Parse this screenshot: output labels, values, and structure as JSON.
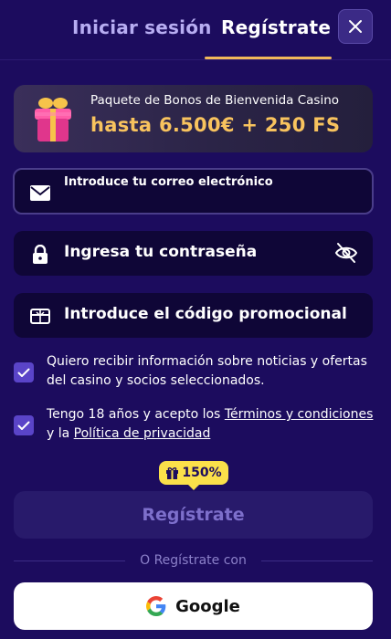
{
  "tabs": {
    "login": "Iniciar sesión",
    "register": "Regístrate",
    "active": "register"
  },
  "close_icon": "close-icon",
  "bonus": {
    "title": "Paquete de Bonos de Bienvenida Casino",
    "amount": "hasta 6.500€ + 250 FS",
    "icon": "gift-icon"
  },
  "form": {
    "email_placeholder": "Introduce tu correo electrónico",
    "password_placeholder": "Ingresa tu contraseña",
    "promo_placeholder": "Introduce el código promocional"
  },
  "consents": {
    "marketing_text": "Quiero recibir información sobre noticias y ofertas del casino y socios seleccionados.",
    "terms_prefix": "Tengo 18 años y acepto los ",
    "terms_link": "Términos y condiciones",
    "terms_mid": " y la ",
    "privacy_link": "Política de privacidad",
    "marketing_checked": true,
    "terms_checked": true
  },
  "badge": {
    "text": "150%",
    "icon": "gift-icon"
  },
  "register_button": "Regístrate",
  "divider_text": "O Regístrate con",
  "google_button": "Google",
  "colors": {
    "background": "#1c0c5e",
    "accent_gold": "#f8c35e",
    "tab_underline": "#f1b95a",
    "badge_yellow": "#fbe04a",
    "checkbox": "#5a44c8"
  }
}
